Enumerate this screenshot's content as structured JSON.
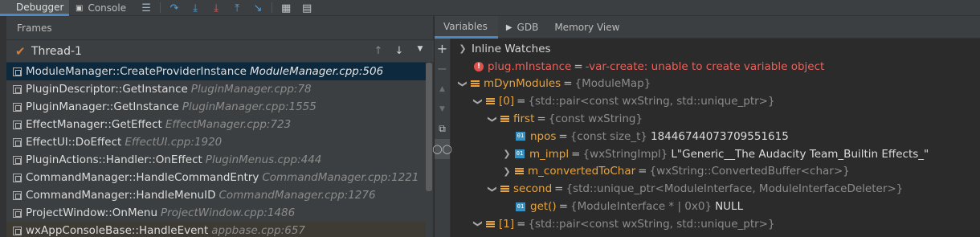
{
  "toolbar": {
    "debugger_label": "Debugger",
    "console_label": "Console",
    "icons": [
      "layout-icon",
      "step-over-icon",
      "step-into-icon",
      "force-step-into-icon",
      "step-out-icon",
      "run-to-cursor-icon",
      "evaluate-icon",
      "table-icon"
    ]
  },
  "frames": {
    "header": "Frames",
    "thread": "Thread-1",
    "items": [
      {
        "fn": "ModuleManager::CreateProviderInstance",
        "file": "ModuleManager.cpp:506"
      },
      {
        "fn": "PluginDescriptor::GetInstance",
        "file": "PluginManager.cpp:78"
      },
      {
        "fn": "PluginManager::GetInstance",
        "file": "PluginManager.cpp:1555"
      },
      {
        "fn": "EffectManager::GetEffect",
        "file": "EffectManager.cpp:723"
      },
      {
        "fn": "EffectUI::DoEffect",
        "file": "EffectUI.cpp:1920"
      },
      {
        "fn": "PluginActions::Handler::OnEffect",
        "file": "PluginMenus.cpp:444"
      },
      {
        "fn": "CommandManager::HandleCommandEntry",
        "file": "CommandManager.cpp:1221"
      },
      {
        "fn": "CommandManager::HandleMenuID",
        "file": "CommandManager.cpp:1276"
      },
      {
        "fn": "ProjectWindow::OnMenu",
        "file": "ProjectWindow.cpp:1486"
      },
      {
        "fn": "wxAppConsoleBase::HandleEvent",
        "file": "appbase.cpp:657"
      }
    ]
  },
  "right_tabs": {
    "variables": "Variables",
    "gdb": "GDB",
    "memory": "Memory View"
  },
  "variables": {
    "inline_watches": "Inline Watches",
    "error_name": "plug.mInstance",
    "error_msg": "-var-create: unable to create variable object",
    "mDynModules": {
      "name": "mDynModules",
      "type": "{ModuleMap}"
    },
    "item0": {
      "name": "[0]",
      "type": "{std::pair<const wxString, std::unique_ptr>}"
    },
    "first": {
      "name": "first",
      "type": "{const wxString}"
    },
    "npos": {
      "name": "npos",
      "type": "{const size_t}",
      "value": "18446744073709551615"
    },
    "m_impl": {
      "name": "m_impl",
      "type": "{wxStringImpl}",
      "value": "L\"Generic__The Audacity Team_Builtin Effects_\""
    },
    "m_converted": {
      "name": "m_convertedToChar",
      "type": "{wxString::ConvertedBuffer<char>}"
    },
    "second": {
      "name": "second",
      "type": "{std::unique_ptr<ModuleInterface, ModuleInterfaceDeleter>}"
    },
    "get": {
      "name": "get()",
      "type": "{ModuleInterface * | 0x0}",
      "value": "NULL"
    },
    "item1": {
      "name": "[1]",
      "type": "{std::pair<const wxString, std::unique_ptr>}"
    }
  },
  "colors": {
    "accent": "#4a88c7",
    "field": "#e8a33d",
    "error": "#e8625b",
    "selected": "#0d293e"
  }
}
